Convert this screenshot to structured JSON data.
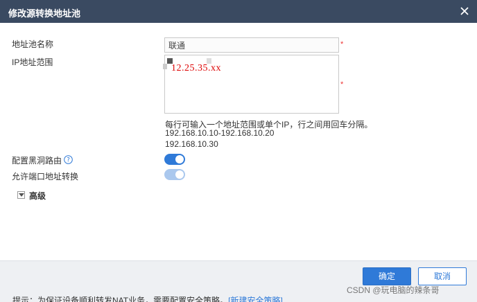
{
  "dialog": {
    "title": "修改源转换地址池",
    "close_icon": "close-icon"
  },
  "form": {
    "pool_name": {
      "label": "地址池名称",
      "value": "联通",
      "required_mark": "*"
    },
    "ip_range": {
      "label": "IP地址范围",
      "value": "12.25.35.xx",
      "required_mark": "*",
      "hint_lines": [
        "每行可输入一个地址范围或单个IP，行之间用回车分隔。",
        "192.168.10.10-192.168.10.20",
        "192.168.10.30"
      ]
    },
    "blackhole_route": {
      "label": "配置黑洞路由",
      "enabled": true,
      "help_icon": "question-circle-icon"
    },
    "port_translation": {
      "label": "允许端口地址转换",
      "enabled": true,
      "disabled": true
    },
    "advanced": {
      "label": "高级",
      "expand_icon": "caret-down-icon"
    }
  },
  "footer": {
    "ok_label": "确定",
    "cancel_label": "取消",
    "tip_text": "提示：为保证设备顺利转发NAT业务，需要配置安全策略。",
    "tip_link": "[新建安全策略]"
  },
  "watermark": "CSDN @玩电脑的辣条哥",
  "colors": {
    "titlebar": "#3a4a61",
    "accent": "#2f7ad8",
    "required": "#ee3333",
    "footer_bg": "#eef0f3"
  }
}
